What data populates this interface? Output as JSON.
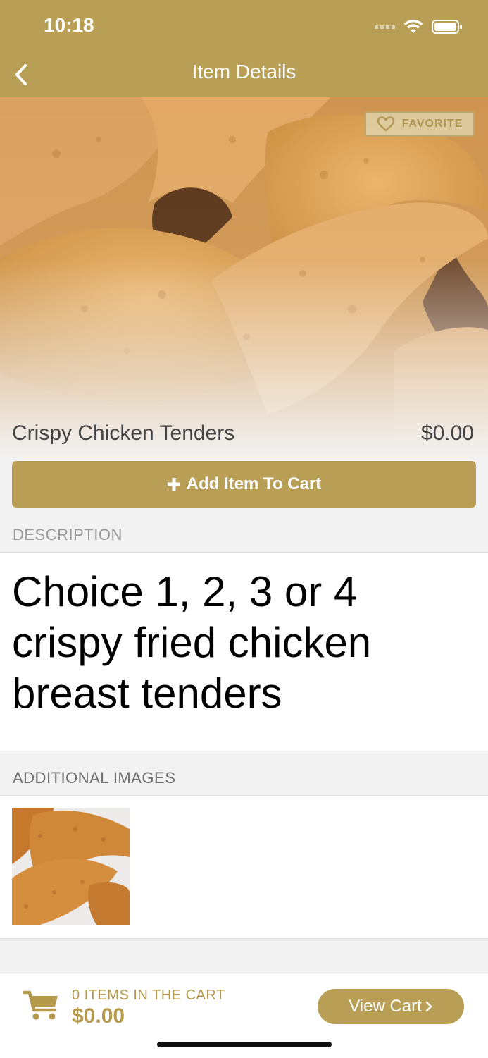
{
  "status": {
    "time": "10:18"
  },
  "nav": {
    "title": "Item Details"
  },
  "hero": {
    "favorite_label": "FAVORITE"
  },
  "item": {
    "name": "Crispy Chicken Tenders",
    "price": "$0.00",
    "add_button_label": "Add Item To Cart"
  },
  "description": {
    "header": "DESCRIPTION",
    "text": "Choice 1, 2, 3 or 4 crispy fried chicken breast tenders"
  },
  "additional_images": {
    "header": "ADDITIONAL IMAGES"
  },
  "cart": {
    "count_label": "0 ITEMS IN THE CART",
    "total": "$0.00",
    "view_cart_label": "View Cart"
  },
  "colors": {
    "brand": "#b89f55",
    "background": "#f2f2f2",
    "text_gold": "#b59a4e"
  },
  "icons": [
    "back-chevron-icon",
    "heart-icon",
    "plus-icon",
    "shopping-cart-icon",
    "chevron-right-icon",
    "wifi-icon",
    "battery-icon"
  ]
}
